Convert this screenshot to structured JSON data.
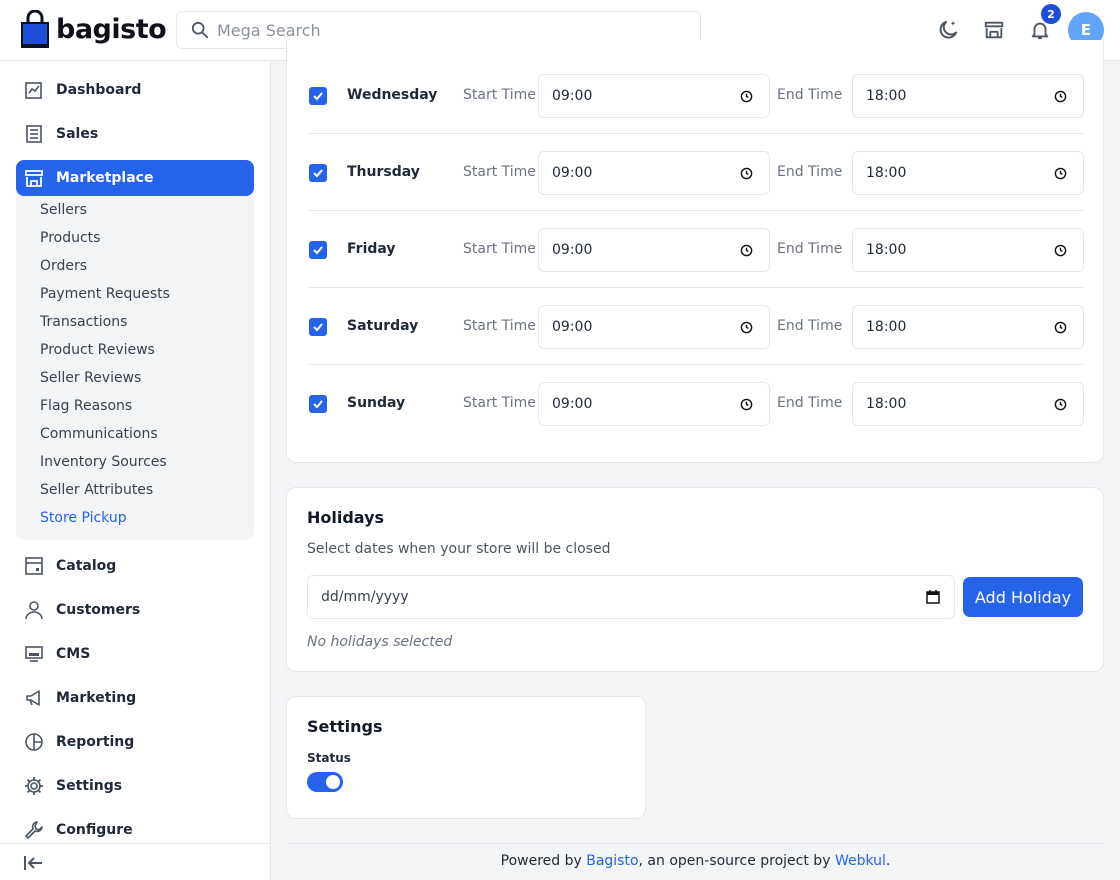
{
  "header": {
    "logo_text": "bagisto",
    "search_placeholder": "Mega Search",
    "notification_count": "2",
    "avatar_initial": "E"
  },
  "sidebar": {
    "items": [
      {
        "label": "Dashboard",
        "icon": "dashboard-icon"
      },
      {
        "label": "Sales",
        "icon": "receipt-icon"
      },
      {
        "label": "Marketplace",
        "icon": "store-icon"
      },
      {
        "label": "Catalog",
        "icon": "catalog-icon"
      },
      {
        "label": "Customers",
        "icon": "user-icon"
      },
      {
        "label": "CMS",
        "icon": "monitor-icon"
      },
      {
        "label": "Marketing",
        "icon": "megaphone-icon"
      },
      {
        "label": "Reporting",
        "icon": "pie-chart-icon"
      },
      {
        "label": "Settings",
        "icon": "gear-icon"
      },
      {
        "label": "Configure",
        "icon": "wrench-icon"
      }
    ],
    "marketplace_sub": [
      "Sellers",
      "Products",
      "Orders",
      "Payment Requests",
      "Transactions",
      "Product Reviews",
      "Seller Reviews",
      "Flag Reasons",
      "Communications",
      "Inventory Sources",
      "Seller Attributes",
      "Store Pickup"
    ],
    "active_sub": "Store Pickup"
  },
  "schedule": {
    "start_label": "Start Time",
    "end_label": "End Time",
    "days": [
      {
        "name": "Wednesday",
        "start": "09:00",
        "end": "18:00",
        "checked": true
      },
      {
        "name": "Thursday",
        "start": "09:00",
        "end": "18:00",
        "checked": true
      },
      {
        "name": "Friday",
        "start": "09:00",
        "end": "18:00",
        "checked": true
      },
      {
        "name": "Saturday",
        "start": "09:00",
        "end": "18:00",
        "checked": true
      },
      {
        "name": "Sunday",
        "start": "09:00",
        "end": "18:00",
        "checked": true
      }
    ]
  },
  "holidays": {
    "title": "Holidays",
    "description": "Select dates when your store will be closed",
    "date_placeholder": "dd/mm/yyyy",
    "add_button": "Add Holiday",
    "empty_text": "No holidays selected"
  },
  "settings": {
    "title": "Settings",
    "status_label": "Status",
    "status_on": true
  },
  "footer": {
    "prefix": "Powered by ",
    "link1": "Bagisto",
    "middle": ", an open-source project by ",
    "link2": "Webkul",
    "suffix": "."
  },
  "colors": {
    "primary": "#2563eb",
    "avatar": "#60a5fa"
  }
}
